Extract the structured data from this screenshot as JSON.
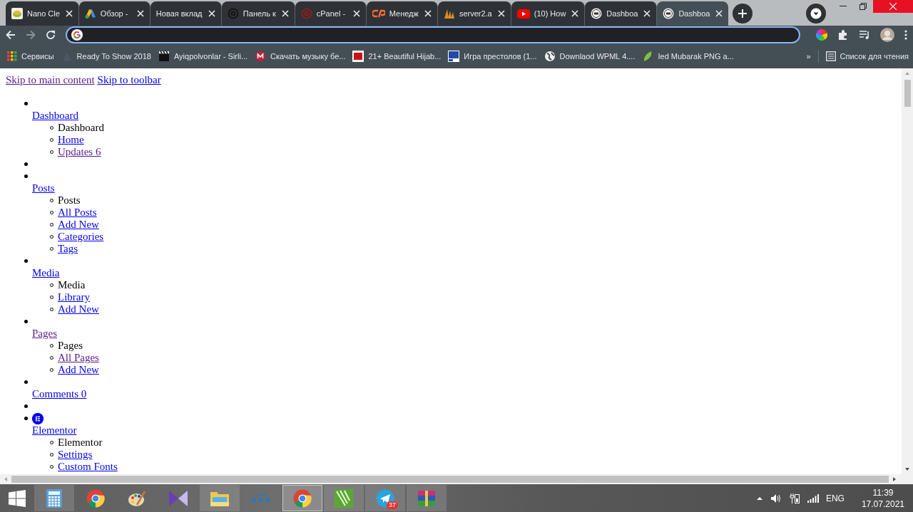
{
  "tabs": [
    {
      "kind": "nano",
      "title": "Nano Cle",
      "selected": false
    },
    {
      "kind": "ads",
      "title": "Обзор - ",
      "selected": false
    },
    {
      "kind": "blank",
      "title": "Новая вклад",
      "selected": false
    },
    {
      "kind": "at-dark",
      "title": "Панель к",
      "selected": false
    },
    {
      "kind": "at-red",
      "title": "cPanel -",
      "selected": false
    },
    {
      "kind": "cpanel",
      "title": "Менедж",
      "selected": false
    },
    {
      "kind": "server",
      "title": "server2.a",
      "selected": false
    },
    {
      "kind": "youtube",
      "title": "(10) How",
      "selected": false
    },
    {
      "kind": "tst",
      "title": "Dashboa",
      "selected": false
    },
    {
      "kind": "tst",
      "title": "Dashboa",
      "selected": true
    }
  ],
  "bookmarks": [
    {
      "kind": "apps",
      "title": "Сервисы"
    },
    {
      "kind": "faint",
      "title": "Ready To Show 2018"
    },
    {
      "kind": "film",
      "title": "Ayiqpolvonlar - Sirli..."
    },
    {
      "kind": "music",
      "title": "Скачать музыку бе..."
    },
    {
      "kind": "ck",
      "title": "21+ Beautiful Hijab..."
    },
    {
      "kind": "s",
      "title": "Игра престолов (1..."
    },
    {
      "kind": "globe",
      "title": "Downlaod WPML 4...."
    },
    {
      "kind": "leaf",
      "title": "Ied Mubarak PNG a..."
    }
  ],
  "bookmarks_more": "»",
  "reading_list": "Список для чтения",
  "page": {
    "skip_links": [
      {
        "label": "Skip to main content",
        "visited": true
      },
      {
        "label": "Skip to toolbar",
        "visited": false
      }
    ],
    "menu": [
      {
        "kind": "item",
        "label": "Dashboard",
        "visited": false,
        "children": [
          {
            "label": "Dashboard",
            "current": true
          },
          {
            "label": "Home",
            "current": false,
            "visited": false
          },
          {
            "label": "Updates 6",
            "current": false,
            "visited": true
          }
        ]
      },
      {
        "kind": "separator"
      },
      {
        "kind": "item",
        "label": "Posts",
        "visited": false,
        "children": [
          {
            "label": "Posts",
            "current": true
          },
          {
            "label": "All Posts",
            "current": false,
            "visited": false
          },
          {
            "label": "Add New",
            "current": false,
            "visited": false
          },
          {
            "label": "Categories",
            "current": false,
            "visited": false
          },
          {
            "label": "Tags",
            "current": false,
            "visited": false
          }
        ]
      },
      {
        "kind": "item",
        "label": "Media",
        "visited": false,
        "children": [
          {
            "label": "Media",
            "current": true
          },
          {
            "label": "Library",
            "current": false,
            "visited": false
          },
          {
            "label": "Add New",
            "current": false,
            "visited": false
          }
        ]
      },
      {
        "kind": "item",
        "label": "Pages",
        "visited": true,
        "children": [
          {
            "label": "Pages",
            "current": true
          },
          {
            "label": "All Pages",
            "current": false,
            "visited": true
          },
          {
            "label": "Add New",
            "current": false,
            "visited": false
          }
        ]
      },
      {
        "kind": "item",
        "label": "Comments 0",
        "visited": false
      },
      {
        "kind": "separator"
      },
      {
        "kind": "icon-item",
        "label": "Elementor",
        "visited": false,
        "children": [
          {
            "label": "Elementor",
            "current": true
          },
          {
            "label": "Settings",
            "current": false,
            "visited": false
          },
          {
            "label": "Custom Fonts",
            "current": false,
            "visited": false
          }
        ]
      }
    ]
  },
  "taskbar": {
    "apps": [
      {
        "kind": "calculator",
        "open": true,
        "selected": false
      },
      {
        "kind": "chrome",
        "open": false,
        "selected": false
      },
      {
        "kind": "paint",
        "open": false,
        "selected": false
      },
      {
        "kind": "player",
        "open": false,
        "selected": false
      },
      {
        "kind": "folder",
        "open": true,
        "selected": false
      },
      {
        "kind": "network",
        "open": false,
        "selected": false
      },
      {
        "kind": "chrome",
        "open": true,
        "selected": true
      },
      {
        "kind": "corel",
        "open": true,
        "selected": false
      },
      {
        "kind": "telegram",
        "open": true,
        "selected": false,
        "badge": "37"
      },
      {
        "kind": "archive",
        "open": true,
        "selected": false
      }
    ],
    "language": "ENG",
    "time": "11:39",
    "date": "17.07.2021"
  }
}
